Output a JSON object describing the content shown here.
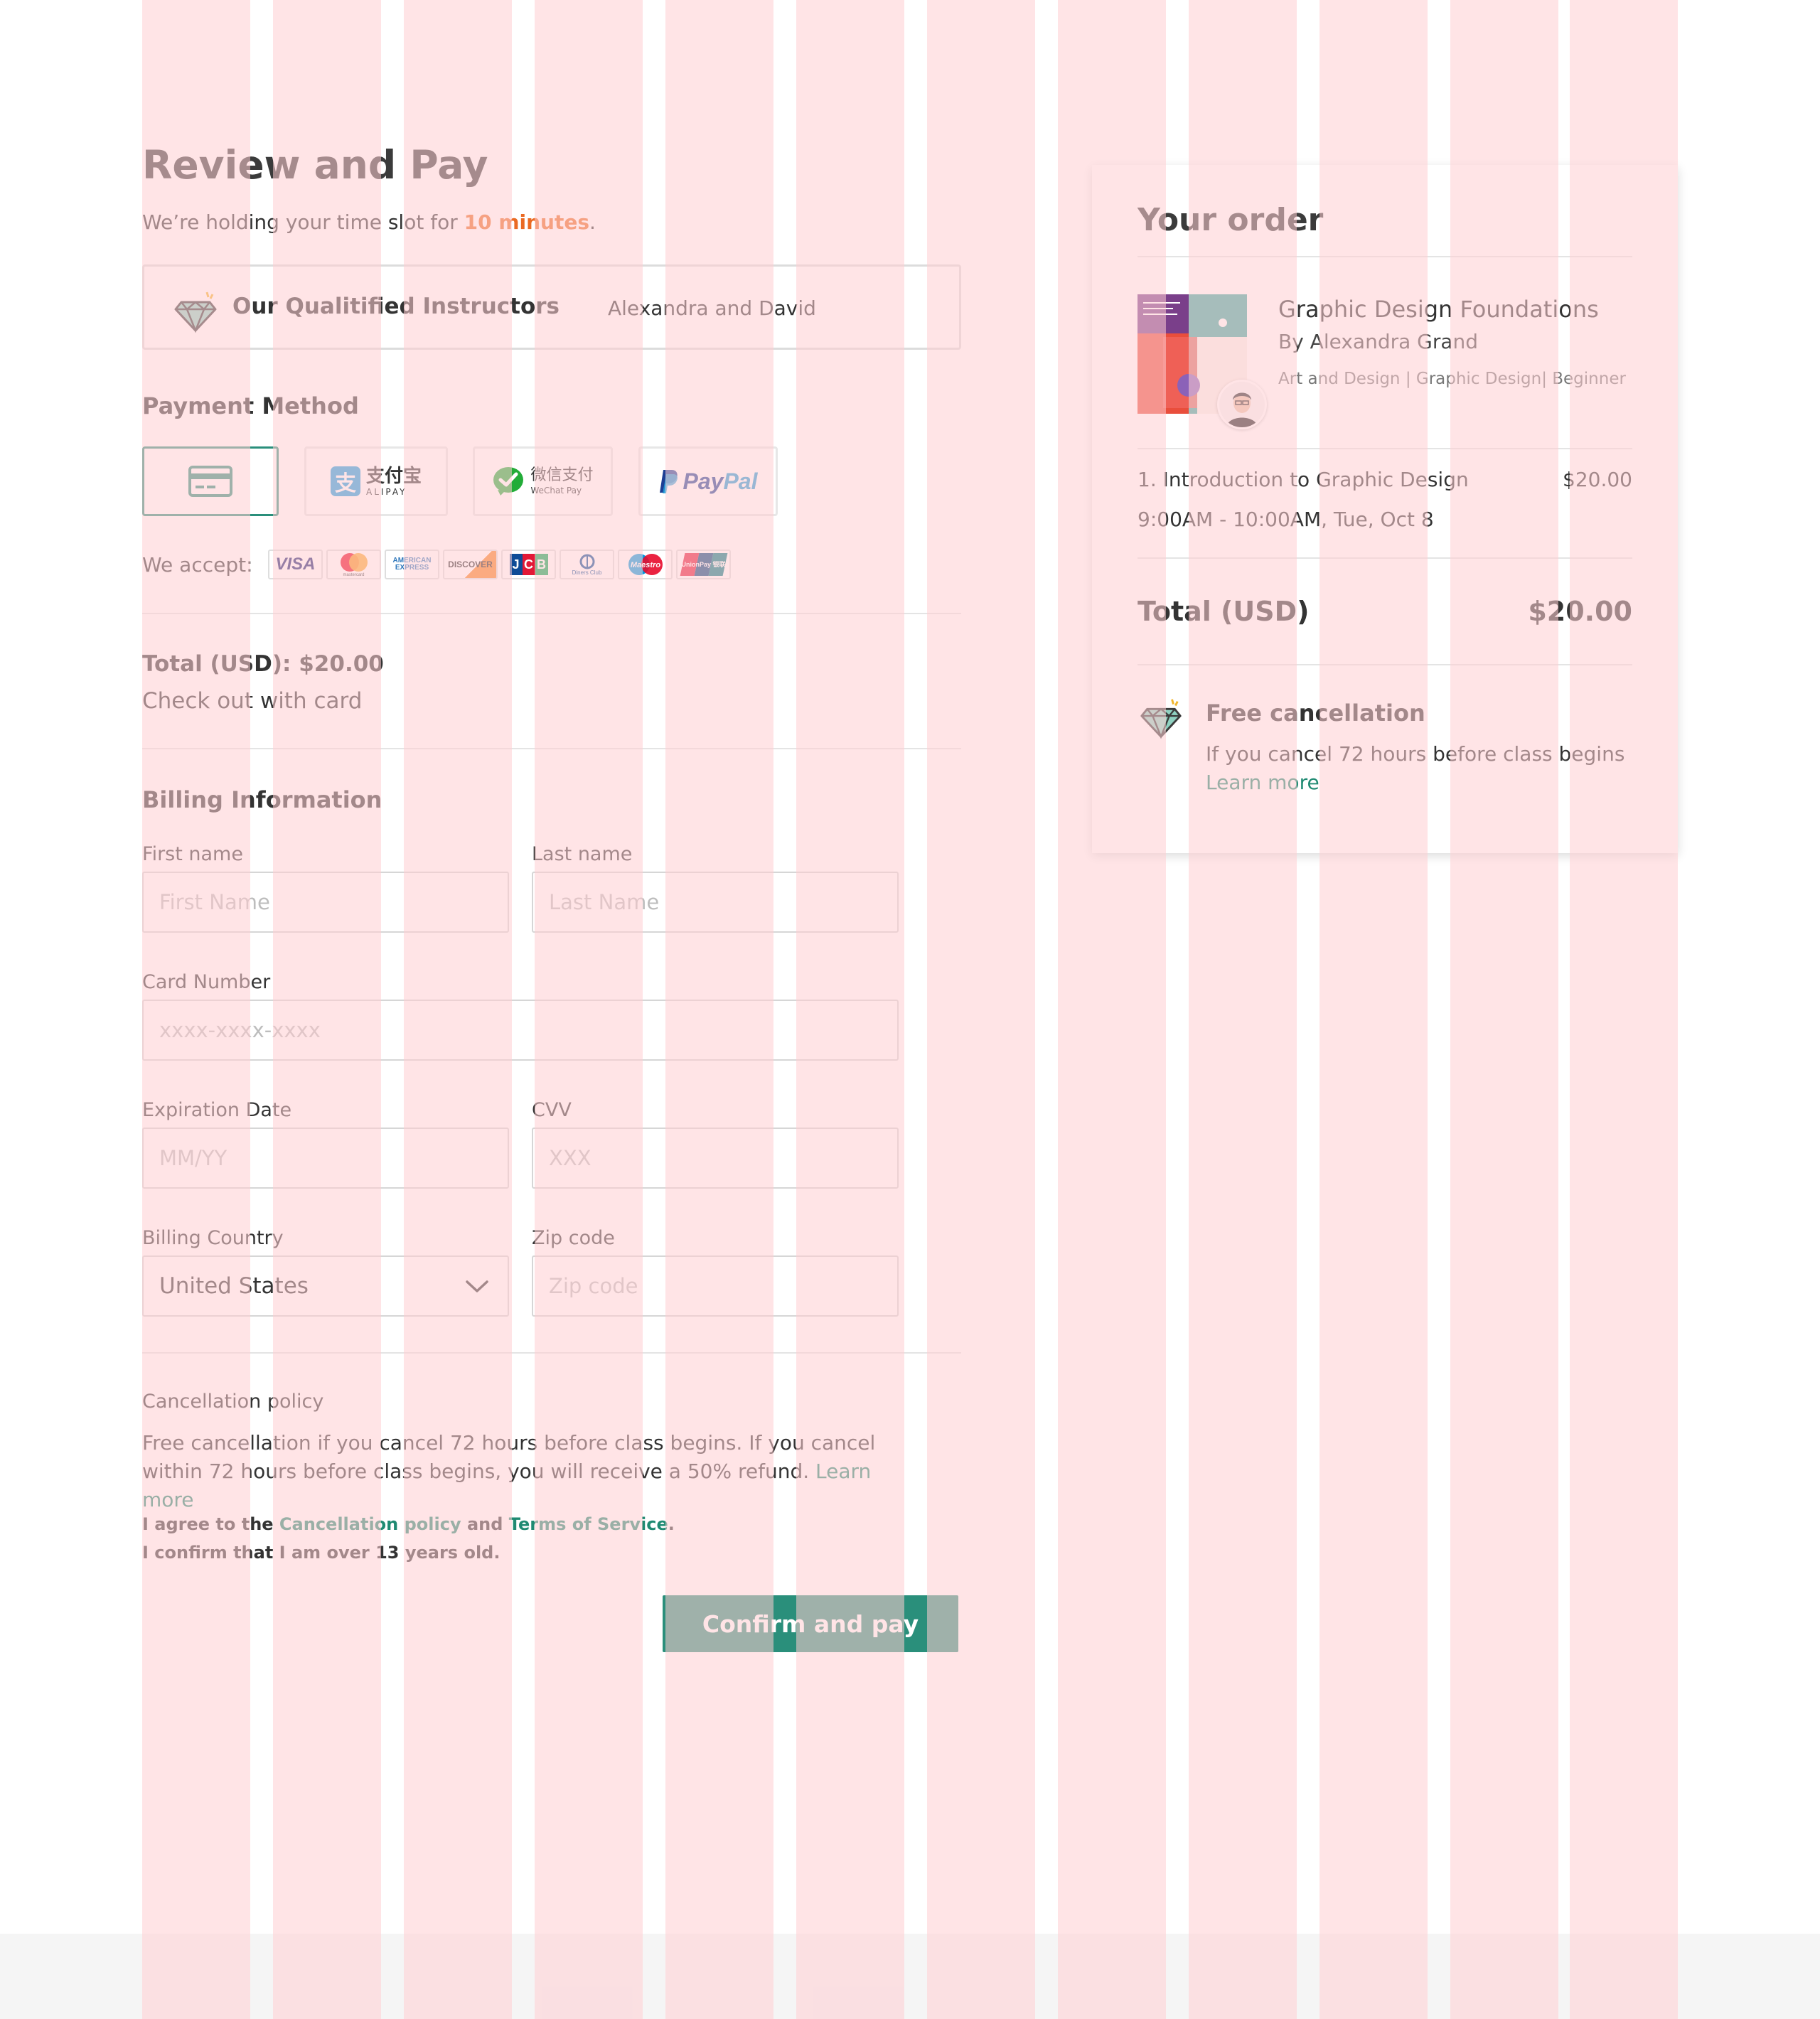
{
  "header": {
    "title": "Review and Pay",
    "hold_prefix": "We’re holding your time slot for",
    "hold_time": "10 minutes",
    "hold_suffix": "."
  },
  "instructors": {
    "label": "Our Qualitified Instructors",
    "names": "Alexandra and David",
    "icon": "diamond-icon"
  },
  "payment": {
    "title": "Payment Method",
    "methods": [
      {
        "name": "card",
        "icon": "credit-card-icon",
        "selected": true
      },
      {
        "name": "alipay",
        "logo_cn": "支付宝",
        "logo_en": "ALIPAY"
      },
      {
        "name": "wechat",
        "logo_cn": "微信支付",
        "logo_en": "WeChat Pay"
      },
      {
        "name": "paypal",
        "logo_pay": "Pay",
        "logo_pal": "Pal"
      }
    ],
    "accept_label": "We accept:",
    "accepted_cards": [
      "VISA",
      "mastercard",
      "AMERICAN EXPRESS",
      "DISCOVER",
      "JCB",
      "Diners Club",
      "Maestro",
      "UnionPay 银联"
    ]
  },
  "summary": {
    "total_line": "Total (USD): $20.00",
    "checkout_line": "Check out with card"
  },
  "billing": {
    "title": "Billing Information",
    "first_name": {
      "label": "First name",
      "placeholder": "First Name",
      "value": ""
    },
    "last_name": {
      "label": "Last name",
      "placeholder": "Last Name",
      "value": ""
    },
    "card_number": {
      "label": "Card Number",
      "placeholder": "xxxx-xxxx-xxxx",
      "value": ""
    },
    "expiration": {
      "label": "Expiration Date",
      "placeholder": "MM/YY",
      "value": ""
    },
    "cvv": {
      "label": "CVV",
      "placeholder": "XXX",
      "value": ""
    },
    "country": {
      "label": "Billing Country",
      "value": "United States"
    },
    "zip": {
      "label": "Zip code",
      "placeholder": "Zip code",
      "value": ""
    }
  },
  "cancellation": {
    "title": "Cancellation policy",
    "text": "Free cancellation if you cancel 72 hours before class begins. If you cancel within 72 hours before class begins, you will receive a 50% refund.",
    "learn_more": "Learn more"
  },
  "agreement": {
    "prefix": "I agree to the",
    "policy_link": "Cancellation policy",
    "and": "and",
    "terms_link": "Terms of Service",
    "period": ".",
    "age_confirm": "I confirm that I am over 13 years old."
  },
  "confirm_button": "Confirm and pay",
  "order": {
    "title": "Your order",
    "course_title": "Graphic Design Foundations",
    "course_author": "By Alexandra Grand",
    "course_tags": "Art and Design | Graphic Design| Beginner",
    "item_name": "1. Introduction to Graphic Design",
    "item_price": "$20.00",
    "item_time": "9:00AM - 10:00AM, Tue, Oct 8",
    "total_label": "Total (USD)",
    "total_value": "$20.00",
    "free_cancel_title": "Free cancellation",
    "free_cancel_text": "If you cancel 72 hours before class begins",
    "learn_more": "Learn more"
  },
  "colors": {
    "accent_green": "#2a8f7b",
    "accent_orange": "#ea6a23",
    "grid_overlay": "#ffcdd2"
  }
}
